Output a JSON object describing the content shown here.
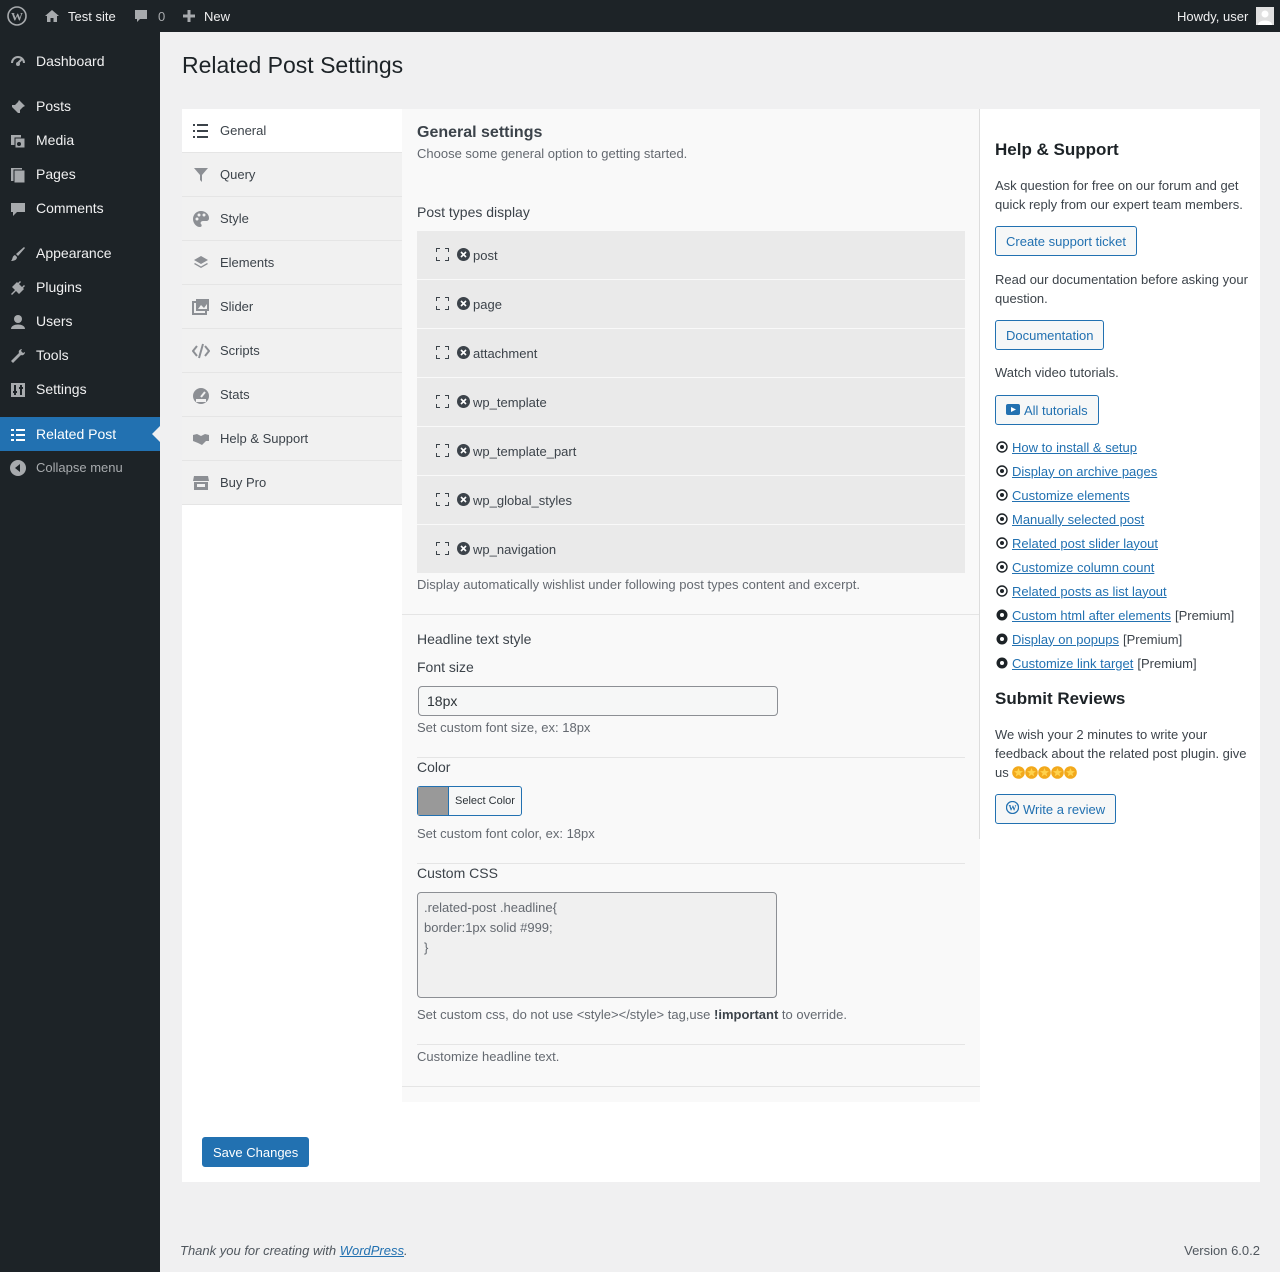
{
  "adminbar": {
    "site": "Test site",
    "comments": "0",
    "new": "New",
    "howdy": "Howdy, user"
  },
  "menu": [
    {
      "label": "Dashboard",
      "icon": "dashboard-icon"
    },
    {
      "label": "Posts",
      "icon": "pin-icon"
    },
    {
      "label": "Media",
      "icon": "media-icon"
    },
    {
      "label": "Pages",
      "icon": "pages-icon"
    },
    {
      "label": "Comments",
      "icon": "comment-icon"
    },
    {
      "label": "Appearance",
      "icon": "brush-icon"
    },
    {
      "label": "Plugins",
      "icon": "plug-icon"
    },
    {
      "label": "Users",
      "icon": "user-icon"
    },
    {
      "label": "Tools",
      "icon": "wrench-icon"
    },
    {
      "label": "Settings",
      "icon": "sliders-icon"
    },
    {
      "label": "Related Post",
      "icon": "list-icon"
    },
    {
      "label": "Collapse menu",
      "icon": "collapse-icon"
    }
  ],
  "page_title": "Related Post Settings",
  "tabs": [
    {
      "label": "General",
      "icon": "list-icon"
    },
    {
      "label": "Query",
      "icon": "filter-icon"
    },
    {
      "label": "Style",
      "icon": "palette-icon"
    },
    {
      "label": "Elements",
      "icon": "layers-icon"
    },
    {
      "label": "Slider",
      "icon": "images-icon"
    },
    {
      "label": "Scripts",
      "icon": "code-icon"
    },
    {
      "label": "Stats",
      "icon": "gauge-icon"
    },
    {
      "label": "Help & Support",
      "icon": "handshake-icon"
    },
    {
      "label": "Buy Pro",
      "icon": "store-icon"
    }
  ],
  "general": {
    "heading": "General settings",
    "subheading": "Choose some general option to getting started.",
    "post_types_label": "Post types display",
    "post_types": [
      "post",
      "page",
      "attachment",
      "wp_template",
      "wp_template_part",
      "wp_global_styles",
      "wp_navigation"
    ],
    "post_types_desc": "Display automatically wishlist under following post types content and excerpt.",
    "headline_label": "Headline text style",
    "font_size_label": "Font size",
    "font_size_value": "18px",
    "font_size_desc": "Set custom font size, ex: 18px",
    "color_label": "Color",
    "color_button": "Select Color",
    "color_value": "#999999",
    "color_desc": "Set custom font color, ex: 18px",
    "css_label": "Custom CSS",
    "css_value": ".related-post .headline{\nborder:1px solid #999;\n}",
    "css_desc_pre": "Set custom css, do not use <style></style> tag,use ",
    "css_desc_strong": "!important",
    "css_desc_post": " to override.",
    "headline_desc": "Customize headline text."
  },
  "help": {
    "title": "Help & Support",
    "ask_text": "Ask question for free on our forum and get quick reply from our expert team members.",
    "ticket_button": "Create support ticket",
    "docs_text": "Read our documentation before asking your question.",
    "docs_button": "Documentation",
    "video_text": "Watch video tutorials.",
    "tutorials_button": "All tutorials",
    "tutorials": [
      {
        "label": "How to install & setup",
        "premium": ""
      },
      {
        "label": "Display on archive pages",
        "premium": ""
      },
      {
        "label": "Customize elements",
        "premium": ""
      },
      {
        "label": "Manually selected post",
        "premium": ""
      },
      {
        "label": "Related post slider layout",
        "premium": ""
      },
      {
        "label": "Customize column count",
        "premium": ""
      },
      {
        "label": "Related posts as list layout",
        "premium": ""
      },
      {
        "label": "Custom html after elements",
        "premium": "[Premium]"
      },
      {
        "label": "Display on popups",
        "premium": "[Premium]"
      },
      {
        "label": "Customize link target",
        "premium": "[Premium]"
      }
    ],
    "reviews_title": "Submit Reviews",
    "reviews_text": "We wish your 2 minutes to write your feedback about the related post plugin. give us",
    "stars": 5,
    "review_button": "Write a review"
  },
  "save_button": "Save Changes",
  "footer": {
    "thanks_pre": "Thank you for creating with ",
    "thanks_link": "WordPress",
    "thanks_post": ".",
    "version": "Version 6.0.2"
  }
}
